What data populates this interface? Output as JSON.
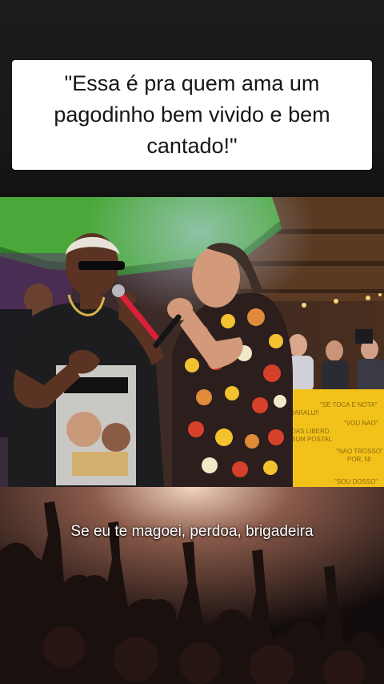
{
  "caption": {
    "text": "\"Essa é pra quem ama um pagodinho bem vivido e bem cantado!\""
  },
  "video": {
    "subtitle": "Se eu te magoei, perdoa, brigadeira"
  },
  "colors": {
    "caption_background": "#ffffff",
    "caption_text": "#161616",
    "page_background": "#141414",
    "subtitle_text": "#ffffff"
  }
}
